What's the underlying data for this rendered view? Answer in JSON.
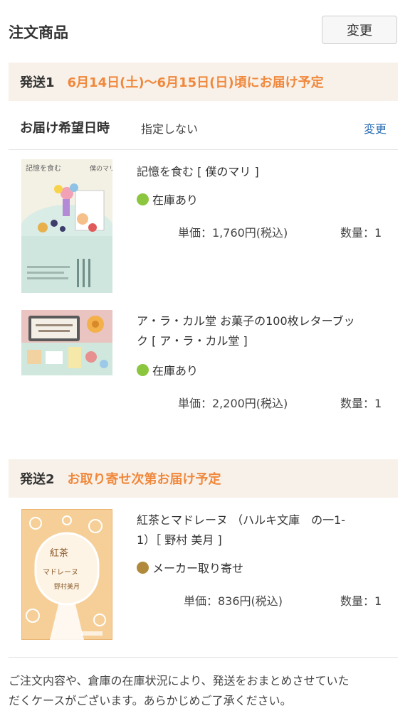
{
  "header": {
    "title": "注文商品",
    "change_label": "変更"
  },
  "shipment1": {
    "label": "発送1",
    "schedule": "6月14日(土)〜6月15日(日)頃にお届け予定",
    "delivery_label": "お届け希望日時",
    "delivery_value": "指定しない",
    "delivery_change": "変更",
    "items": [
      {
        "title_line1": "記憶を食む [ 僕のマリ ]",
        "title_line2": "",
        "stock": "在庫あり",
        "stock_color": "#8cc63f",
        "price": "単価：1,760円(税込)",
        "qty": "数量：1",
        "cover_text_a": "記憶を食む",
        "cover_text_b": "僕のマリ"
      },
      {
        "title_line1": "ア・ラ・カル堂 お菓子の100枚レターブッ",
        "title_line2": "ク [ ア・ラ・カル堂 ]",
        "stock": "在庫あり",
        "stock_color": "#8cc63f",
        "price": "単価：2,200円(税込)",
        "qty": "数量：1"
      }
    ]
  },
  "shipment2": {
    "label": "発送2",
    "schedule": "お取り寄せ次第お届け予定",
    "items": [
      {
        "title_line1": "紅茶とマドレーヌ （ハルキ文庫　の一1-",
        "title_line2": "1）［ 野村 美月 ]",
        "stock": "メーカー取り寄せ",
        "stock_color": "#b08a3a",
        "price": "単価：836円(税込)",
        "qty": "数量：1",
        "cover_text_a": "紅茶",
        "cover_text_b": "マドレーヌ",
        "cover_text_c": "野村美月"
      }
    ]
  },
  "footer": {
    "line1": "ご注文内容や、倉庫の在庫状況により、発送をおまとめさせていた",
    "line2": "だくケースがございます。あらかじめご了承ください。"
  }
}
